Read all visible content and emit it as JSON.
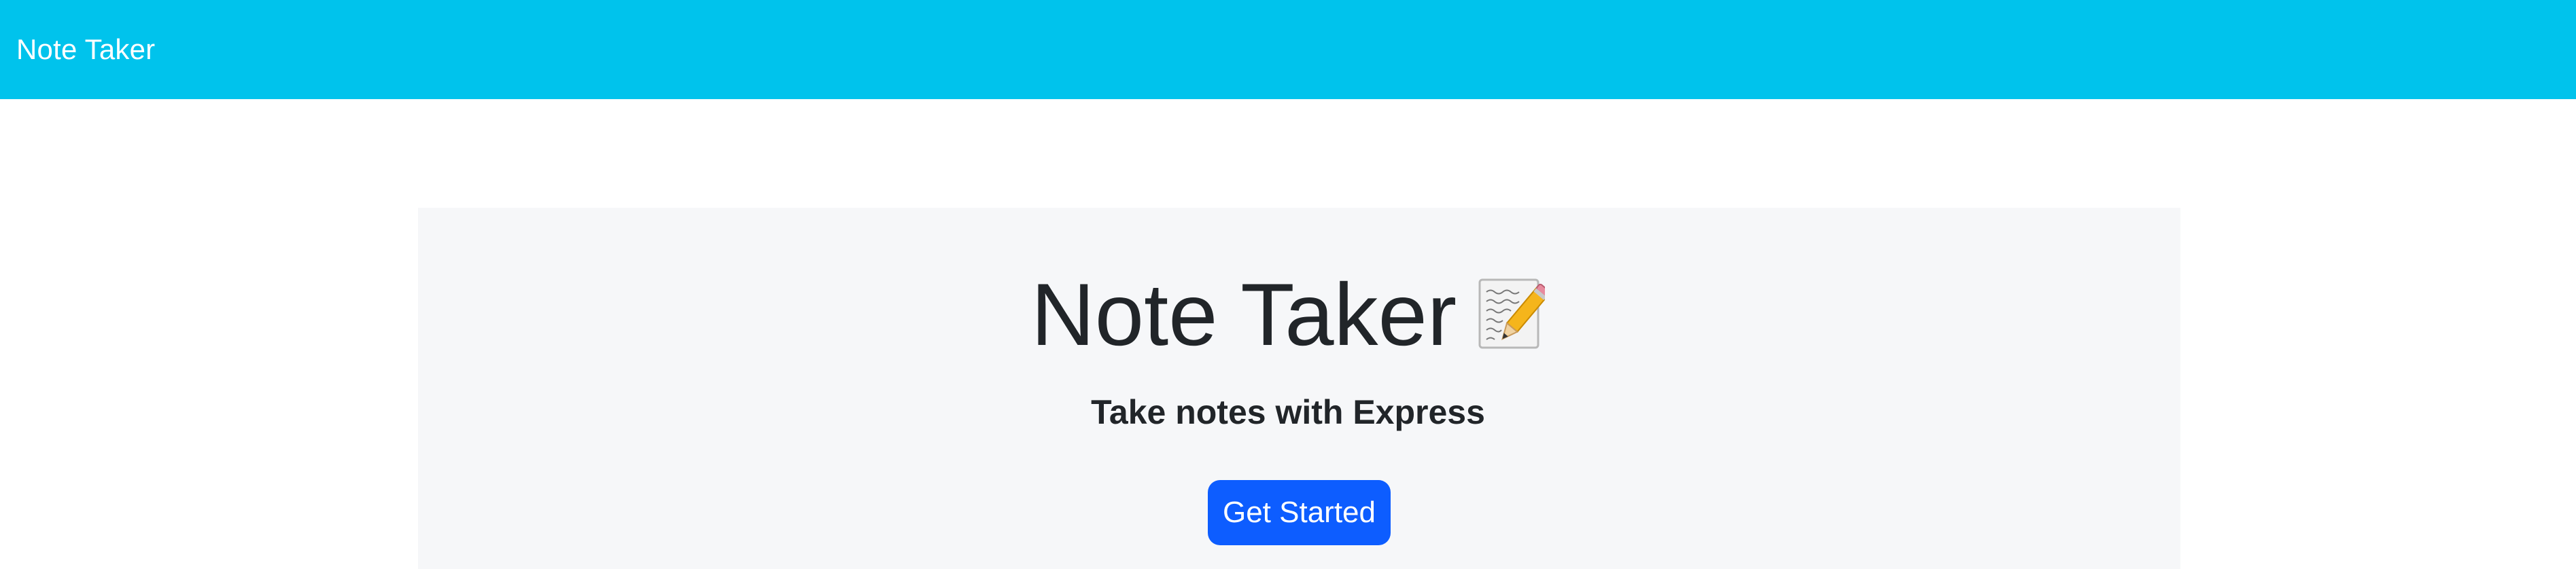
{
  "navbar": {
    "brand": "Note Taker",
    "background_color": "#00c3ec"
  },
  "hero": {
    "title": "Note Taker",
    "title_icon": "memo-icon",
    "subtitle": "Take notes with Express",
    "button_label": "Get Started",
    "button_color": "#0d5dff",
    "panel_color": "#f6f7f9"
  }
}
